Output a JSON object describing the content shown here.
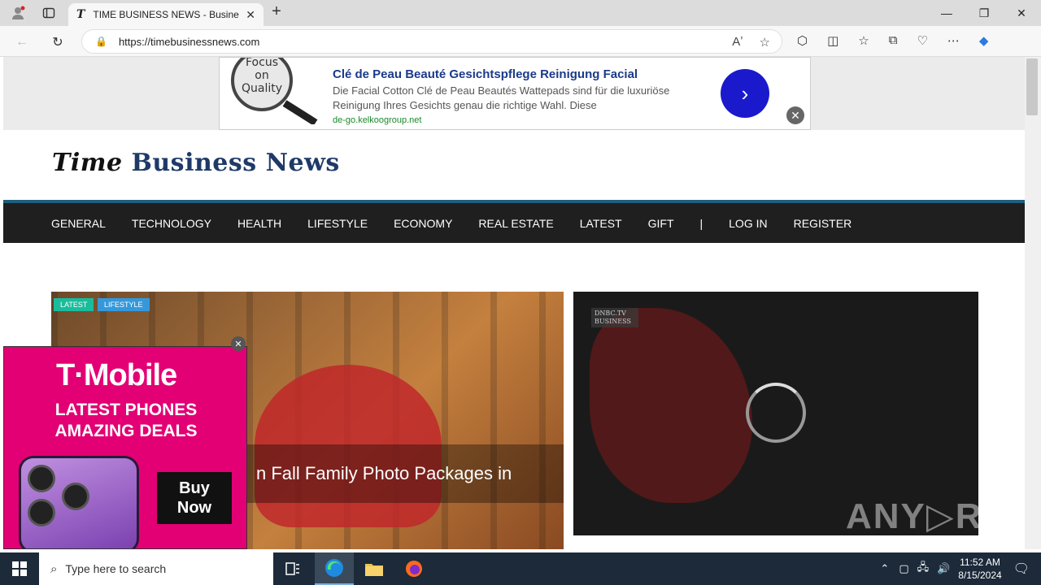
{
  "browser": {
    "tab_title": "TIME BUSINESS NEWS - Business",
    "tab_favicon": "T",
    "url": "https://timebusinessnews.com",
    "read_aloud_label": "Aʼ",
    "window_controls": [
      "—",
      "❐",
      "✕"
    ]
  },
  "top_ad": {
    "headline": "Clé de Peau Beauté Gesichtspflege Reinigung Facial",
    "body": "Die Facial Cotton Clé de Peau Beautés Wattepads sind für die luxuriöse Reinigung Ihres Gesichts genau die richtige Wahl. Diese",
    "domain": "de-go.kelkoogroup.net",
    "image_text": "Focus on Quality"
  },
  "site": {
    "logo_part1": "Time",
    "logo_part2": "Business News",
    "nav": [
      "GENERAL",
      "TECHNOLOGY",
      "HEALTH",
      "LIFESTYLE",
      "ECONOMY",
      "REAL ESTATE",
      "LATEST",
      "GIFT",
      "|",
      "LOG IN",
      "REGISTER"
    ]
  },
  "hero": {
    "tags": [
      "LATEST",
      "LIFESTYLE"
    ],
    "caption": "n Fall Family Photo Packages in"
  },
  "video": {
    "channel_logo": "DNBC.TV BUSINESS"
  },
  "side_ad": {
    "brand": "T·Mobile",
    "line1": "LATEST PHONES",
    "line2": "AMAZING DEALS",
    "cta_line1": "Buy",
    "cta_line2": "Now"
  },
  "watermark": "ANY▷RUN",
  "taskbar": {
    "search_placeholder": "Type here to search",
    "time": "11:52 AM",
    "date": "8/15/2024"
  }
}
